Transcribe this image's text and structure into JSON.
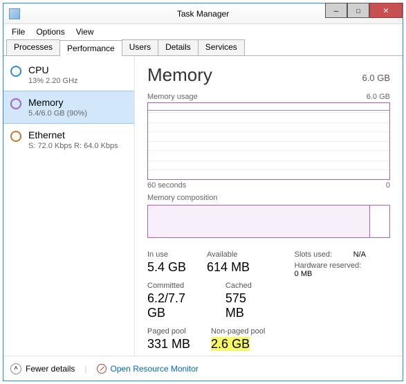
{
  "window": {
    "title": "Task Manager"
  },
  "menu": {
    "items": [
      "File",
      "Options",
      "View"
    ]
  },
  "tabs": {
    "items": [
      "Processes",
      "Performance",
      "Users",
      "Details",
      "Services"
    ],
    "active": "Performance"
  },
  "sidebar": {
    "items": [
      {
        "name": "CPU",
        "sub": "13%  2.20 GHz",
        "color": "cpu",
        "selected": false
      },
      {
        "name": "Memory",
        "sub": "5.4/6.0 GB (90%)",
        "color": "mem",
        "selected": true
      },
      {
        "name": "Ethernet",
        "sub": "S: 72.0 Kbps  R: 64.0 Kbps",
        "color": "eth",
        "selected": false
      }
    ]
  },
  "main": {
    "heading": "Memory",
    "total": "6.0 GB",
    "usage_label": "Memory usage",
    "usage_max": "6.0 GB",
    "axis_left": "60 seconds",
    "axis_right": "0",
    "composition_label": "Memory composition",
    "stats": {
      "in_use_label": "In use",
      "in_use": "5.4 GB",
      "available_label": "Available",
      "available": "614 MB",
      "committed_label": "Committed",
      "committed": "6.2/7.7 GB",
      "cached_label": "Cached",
      "cached": "575 MB",
      "paged_label": "Paged pool",
      "paged": "331 MB",
      "nonpaged_label": "Non-paged pool",
      "nonpaged": "2.6 GB"
    },
    "info": {
      "slots_label": "Slots used:",
      "slots": "N/A",
      "reserved_label": "Hardware reserved:",
      "reserved": "0 MB"
    }
  },
  "footer": {
    "fewer": "Fewer details",
    "resmon": "Open Resource Monitor"
  }
}
